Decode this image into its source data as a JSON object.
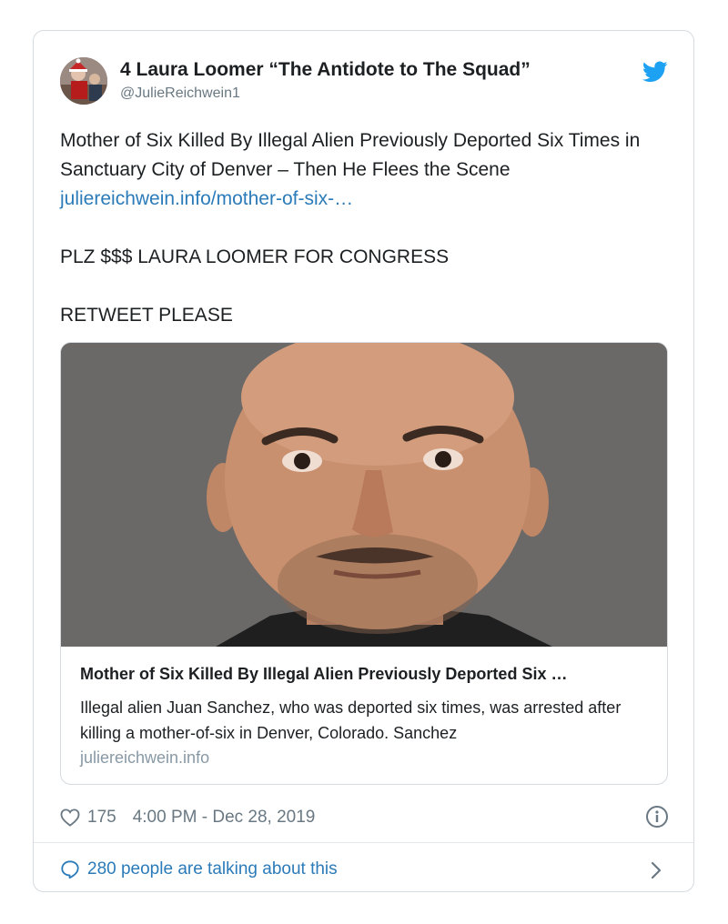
{
  "tweet": {
    "author_name": "4 Laura Loomer “The Antidote to The Squad”",
    "handle": "@JulieReichwein1",
    "text_line1": "Mother of Six Killed By Illegal Alien Previously Deported Six Times in Sanctuary City of Denver – Then He Flees the Scene",
    "text_link": "juliereichwein.info/mother-of-six-…",
    "text_line2": "PLZ $$$ LAURA LOOMER FOR CONGRESS",
    "text_line3": "RETWEET PLEASE",
    "icons": {
      "brand": "twitter-bird-icon",
      "like": "heart-icon",
      "info": "info-icon",
      "conversation": "speech-bubble-icon",
      "more": "chevron-right-icon"
    },
    "colors": {
      "link": "#2b7bb9",
      "brand": "#1da1f2",
      "secondary_text": "#697882"
    }
  },
  "link_card": {
    "title": "Mother of Six Killed By Illegal Alien Previously Deported Six …",
    "description": "Illegal alien Juan Sanchez, who was deported six times, was arrested after killing a mother-of-six in Denver, Colorado. Sanchez",
    "domain": "juliereichwein.info"
  },
  "meta": {
    "likes": "175",
    "timestamp": "4:00 PM - Dec 28, 2019"
  },
  "footer": {
    "conversation_label": "280 people are talking about this"
  }
}
